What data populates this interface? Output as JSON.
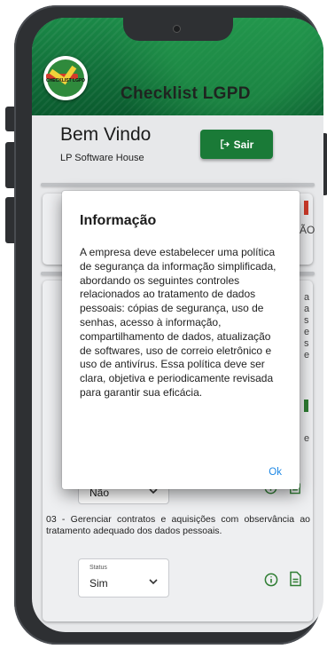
{
  "app": {
    "title": "Checklist LGPD",
    "logo_text": "CHECKLIST LGPD"
  },
  "welcome": {
    "title": "Bem Vindo",
    "subtitle": "LP Software House",
    "logout_label": "Sair"
  },
  "dialog": {
    "title": "Informação",
    "body": "A empresa deve estabelecer uma política de segurança da informação simplificada, abordando os seguintes controles relacionados ao tratamento de dados pessoais: cópias de segurança, uso de senhas, acesso à informação, compartilhamento de dados, atualização de softwares, uso de correio eletrônico e uso de antivírus. Essa política deve ser clara, objetiva e periodicamente revisada para garantir sua eficácia.",
    "ok_label": "Ok"
  },
  "background": {
    "edge_ao": "ÃO",
    "edge_letters": [
      "a",
      "a",
      "s",
      "e",
      "s",
      "e"
    ],
    "edge_e": "e"
  },
  "checklist": {
    "item2_status_value": "Não",
    "item3": {
      "text": "03 - Gerenciar contratos e aquisições com observância ao tratamento adequado dos dados pessoais.",
      "status_label": "Status",
      "status_value": "Sim"
    }
  },
  "colors": {
    "header_green": "#0c6b37",
    "button_green": "#1a7a37",
    "ok_blue": "#1e88e5",
    "alert_red": "#d23b2a"
  }
}
